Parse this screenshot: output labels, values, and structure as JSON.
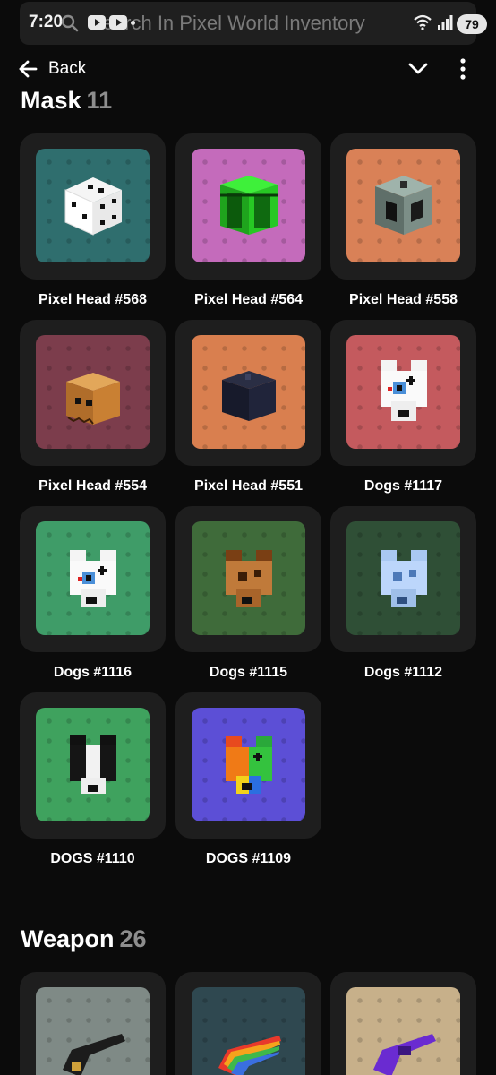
{
  "status": {
    "time": "7:20",
    "battery": "79"
  },
  "search": {
    "text": "Search In Pixel World Inventory"
  },
  "nav": {
    "back_label": "Back"
  },
  "sections": [
    {
      "title": "Mask",
      "count": "11",
      "items": [
        {
          "name": "Pixel Head #568",
          "bg": "#2f6e6e",
          "sprite": "dice-icon"
        },
        {
          "name": "Pixel Head #564",
          "bg": "#c46bbb",
          "sprite": "green-chest-icon"
        },
        {
          "name": "Pixel Head #558",
          "bg": "#d98157",
          "sprite": "metal-cube-icon"
        },
        {
          "name": "Pixel Head #554",
          "bg": "#7c3d4c",
          "sprite": "pumpkin-box-icon"
        },
        {
          "name": "Pixel Head #551",
          "bg": "#d97f4f",
          "sprite": "dark-cube-icon"
        },
        {
          "name": "Dogs #1117",
          "bg": "#c45a5e",
          "sprite": "white-dog-icon"
        },
        {
          "name": "Dogs #1116",
          "bg": "#3f9c68",
          "sprite": "white-dog-icon"
        },
        {
          "name": "Dogs #1115",
          "bg": "#3f6b3a",
          "sprite": "brown-dog-icon"
        },
        {
          "name": "Dogs #1112",
          "bg": "#2f4f36",
          "sprite": "blue-dog-icon"
        },
        {
          "name": "DOGS #1110",
          "bg": "#3fa25e",
          "sprite": "black-dog-icon"
        },
        {
          "name": "DOGS #1109",
          "bg": "#5c4fd6",
          "sprite": "rainbow-dog-icon"
        }
      ]
    },
    {
      "title": "Weapon",
      "count": "26",
      "items": [
        {
          "name": "",
          "bg": "#7f8a86",
          "sprite": "black-revolver-icon"
        },
        {
          "name": "",
          "bg": "#2f4850",
          "sprite": "rainbow-revolver-icon"
        },
        {
          "name": "",
          "bg": "#c7b08a",
          "sprite": "purple-revolver-icon"
        }
      ]
    }
  ]
}
